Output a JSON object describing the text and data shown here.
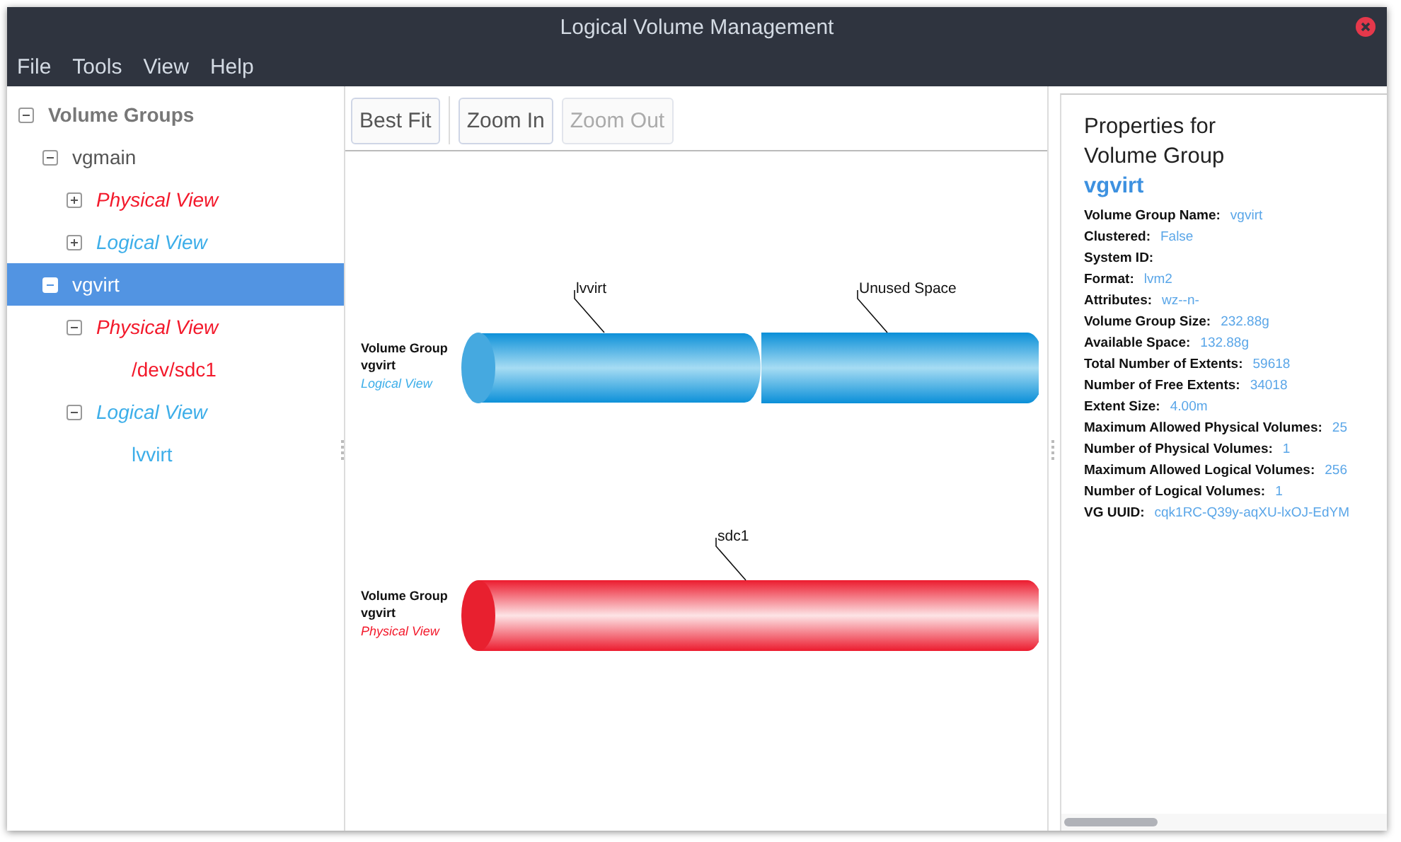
{
  "window": {
    "title": "Logical Volume Management"
  },
  "menu": [
    "File",
    "Tools",
    "View",
    "Help"
  ],
  "tree": [
    {
      "label": "Volume Groups",
      "kind": "root",
      "expanded": true,
      "selected": false,
      "children": [
        {
          "label": "vgmain",
          "kind": "group",
          "expanded": true,
          "selected": false,
          "children": [
            {
              "label": "Physical View",
              "kind": "physical",
              "expanded": false,
              "selected": false
            },
            {
              "label": "Logical View",
              "kind": "logical",
              "expanded": false,
              "selected": false
            }
          ]
        },
        {
          "label": "vgvirt",
          "kind": "group",
          "expanded": true,
          "selected": true,
          "children": [
            {
              "label": "Physical View",
              "kind": "physical",
              "expanded": true,
              "selected": false,
              "children": [
                {
                  "label": "/dev/sdc1",
                  "kind": "pv",
                  "selected": false
                }
              ]
            },
            {
              "label": "Logical View",
              "kind": "logical",
              "expanded": true,
              "selected": false,
              "children": [
                {
                  "label": "lvvirt",
                  "kind": "lv",
                  "selected": false
                }
              ]
            }
          ]
        }
      ]
    }
  ],
  "toolbar": [
    {
      "label": "Best Fit",
      "disabled": false
    },
    {
      "label": "Zoom In",
      "disabled": false
    },
    {
      "label": "Zoom Out",
      "disabled": true
    }
  ],
  "diagrams": [
    {
      "title": "Volume Group",
      "name": "vgvirt",
      "view": "Logical View",
      "kind": "logical",
      "segments": [
        {
          "label": "lvvirt"
        },
        {
          "label": "Unused Space"
        }
      ]
    },
    {
      "title": "Volume Group",
      "name": "vgvirt",
      "view": "Physical View",
      "kind": "physical",
      "segments": [
        {
          "label": "sdc1"
        }
      ]
    }
  ],
  "properties": {
    "heading": [
      "Properties for",
      "Volume Group"
    ],
    "name": "vgvirt",
    "rows": [
      {
        "label": "Volume Group Name:",
        "value": "vgvirt"
      },
      {
        "label": "Clustered:",
        "value": "False"
      },
      {
        "label": "System ID:"
      },
      {
        "label": "Format:",
        "value": "lvm2"
      },
      {
        "label": "Attributes:",
        "value": "wz--n-"
      },
      {
        "label": "Volume Group Size:",
        "value": "232.88g"
      },
      {
        "label": "Available Space:",
        "value": "132.88g"
      },
      {
        "label": "Total Number of Extents:",
        "value": "59618"
      },
      {
        "label": "Number of Free Extents:",
        "value": "34018"
      },
      {
        "label": "Extent Size:",
        "value": "4.00m"
      },
      {
        "label": "Maximum Allowed Physical Volumes:",
        "value": "25"
      },
      {
        "label": "Number of Physical Volumes:",
        "value": "1"
      },
      {
        "label": "Maximum Allowed Logical Volumes:",
        "value": "256"
      },
      {
        "label": "Number of Logical Volumes:",
        "value": "1"
      },
      {
        "label": "VG UUID:",
        "value": "cqk1RC-Q39y-aqXU-lxOJ-EdYM"
      }
    ]
  }
}
